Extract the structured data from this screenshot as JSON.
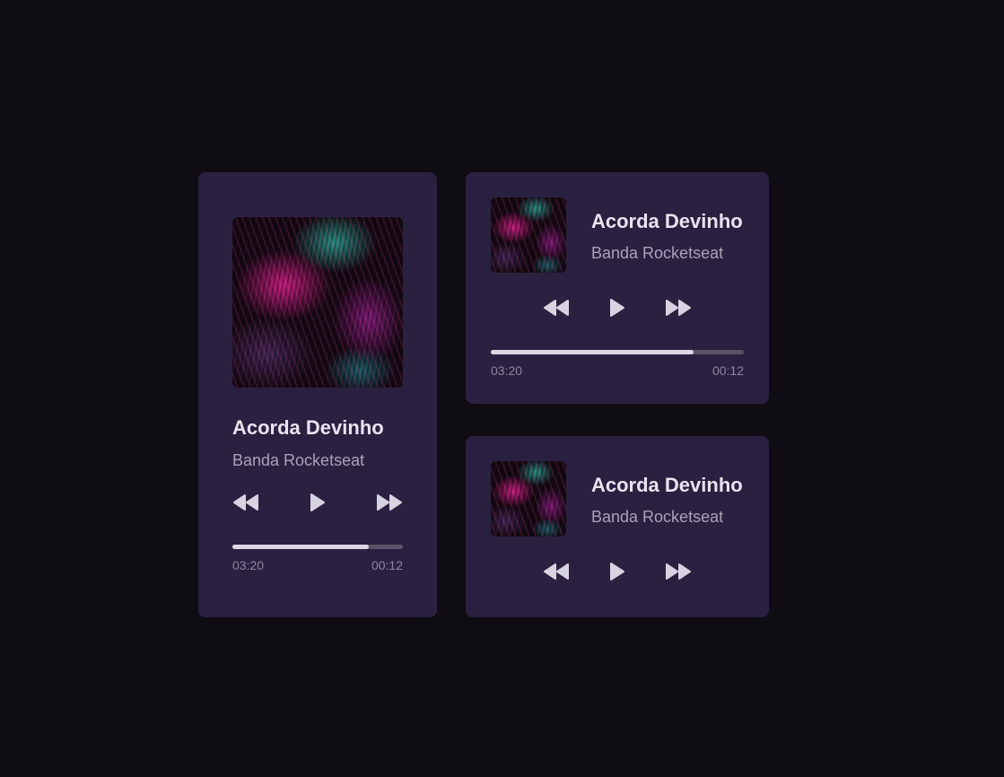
{
  "colors": {
    "background": "#0f0d13",
    "card": "#2a2141",
    "title": "#e9e4f0",
    "artist": "#a9a2b8",
    "icon": "#d8d3e0",
    "progress_fill": "#dcd7e4",
    "progress_track": "#5a5368"
  },
  "players": [
    {
      "title": "Acorda Devinho",
      "artist": "Banda Rocketseat",
      "time_current": "03:20",
      "time_total": "00:12",
      "progress": 0.8
    },
    {
      "title": "Acorda Devinho",
      "artist": "Banda Rocketseat",
      "time_current": "03:20",
      "time_total": "00:12",
      "progress": 0.8
    },
    {
      "title": "Acorda Devinho",
      "artist": "Banda Rocketseat"
    }
  ],
  "icons": {
    "prev": "rewind-icon",
    "play": "play-icon",
    "next": "fast-forward-icon",
    "cover": "album-cover-image"
  }
}
